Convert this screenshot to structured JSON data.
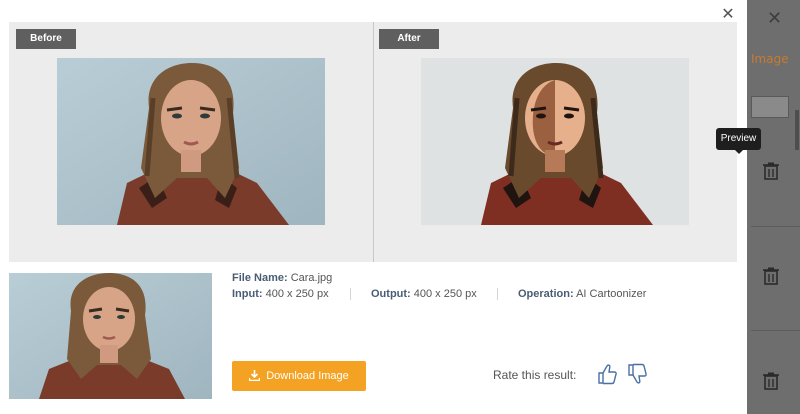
{
  "compare": {
    "before_label": "Before",
    "after_label": "After"
  },
  "file_info": {
    "file_name_label": "File Name:",
    "file_name": "Cara.jpg",
    "input_label": "Input:",
    "input_value": "400 x 250 px",
    "output_label": "Output:",
    "output_value": "400 x 250 px",
    "operation_label": "Operation:",
    "operation_value": "AI Cartoonizer"
  },
  "actions": {
    "download_label": "Download Image",
    "rate_label": "Rate this result:"
  },
  "tooltip": {
    "text": "Preview"
  },
  "background_panel": {
    "link_text": "Image"
  },
  "colors": {
    "accent": "#f4a223",
    "tag_bg": "#5f5f5f",
    "overlay": "#6e6e6e"
  }
}
